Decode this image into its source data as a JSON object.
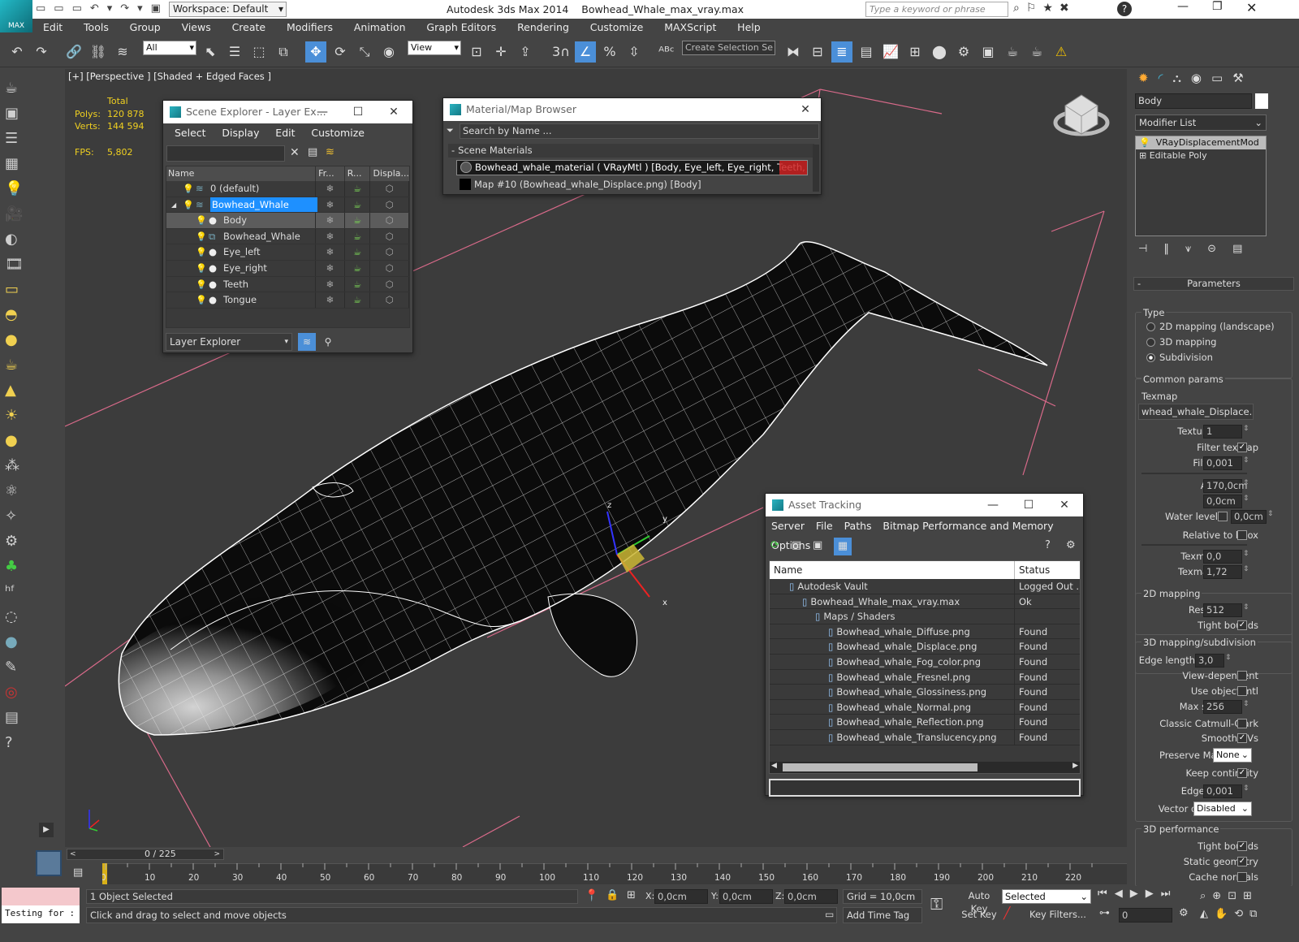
{
  "app": {
    "title": "Autodesk 3ds Max  2014",
    "file": "Bowhead_Whale_max_vray.max",
    "workspace": "Workspace: Default",
    "search_placeholder": "Type a keyword or phrase",
    "logo": "MAX"
  },
  "menu": [
    "Edit",
    "Tools",
    "Group",
    "Views",
    "Create",
    "Modifiers",
    "Animation",
    "Graph Editors",
    "Rendering",
    "Customize",
    "MAXScript",
    "Help"
  ],
  "toolbar": {
    "filter": "All",
    "refcoord": "View",
    "selection_set_placeholder": "Create Selection Se",
    "snap_label": "3"
  },
  "viewport": {
    "label": "[+] [Perspective ] [Shaded + Edged Faces ]",
    "stats": {
      "total_label": "Total",
      "polys_label": "Polys:",
      "polys": "120 878",
      "verts_label": "Verts:",
      "verts": "144 594",
      "fps_label": "FPS:",
      "fps": "5,802"
    },
    "gizmo": {
      "x": "x",
      "y": "y",
      "z": "z"
    }
  },
  "scene_explorer": {
    "title": "Scene Explorer - Layer Ex...",
    "menu": [
      "Select",
      "Display",
      "Edit",
      "Customize"
    ],
    "columns": [
      "Name",
      "Fr...",
      "R...",
      "Displa..."
    ],
    "rows": [
      {
        "name": "0 (default)",
        "indent": 0,
        "type": "layer"
      },
      {
        "name": "Bowhead_Whale",
        "indent": 0,
        "type": "layer",
        "selected": true
      },
      {
        "name": "Body",
        "indent": 1,
        "type": "object",
        "highlight": true
      },
      {
        "name": "Bowhead_Whale",
        "indent": 1,
        "type": "group"
      },
      {
        "name": "Eye_left",
        "indent": 1,
        "type": "object"
      },
      {
        "name": "Eye_right",
        "indent": 1,
        "type": "object"
      },
      {
        "name": "Teeth",
        "indent": 1,
        "type": "object"
      },
      {
        "name": "Tongue",
        "indent": 1,
        "type": "object"
      }
    ],
    "footer": "Layer Explorer"
  },
  "material_browser": {
    "title": "Material/Map Browser",
    "search_placeholder": "Search by Name ...",
    "section": "Scene Materials",
    "items": [
      "Bowhead_whale_material  ( VRayMtl ) [Body, Eye_left, Eye_right, Teeth, Tongue]",
      "Map #10 (Bowhead_whale_Displace.png) [Body]"
    ]
  },
  "asset_tracking": {
    "title": "Asset Tracking",
    "menu": [
      "Server",
      "File",
      "Paths",
      "Bitmap Performance and Memory",
      "Options"
    ],
    "columns": [
      "Name",
      "Status"
    ],
    "rows": [
      {
        "name": "Autodesk Vault",
        "status": "Logged Out ...",
        "indent": 1
      },
      {
        "name": "Bowhead_Whale_max_vray.max",
        "status": "Ok",
        "indent": 2
      },
      {
        "name": "Maps / Shaders",
        "status": "",
        "indent": 3
      },
      {
        "name": "Bowhead_whale_Diffuse.png",
        "status": "Found",
        "indent": 4
      },
      {
        "name": "Bowhead_whale_Displace.png",
        "status": "Found",
        "indent": 4
      },
      {
        "name": "Bowhead_whale_Fog_color.png",
        "status": "Found",
        "indent": 4
      },
      {
        "name": "Bowhead_whale_Fresnel.png",
        "status": "Found",
        "indent": 4
      },
      {
        "name": "Bowhead_whale_Glossiness.png",
        "status": "Found",
        "indent": 4
      },
      {
        "name": "Bowhead_whale_Normal.png",
        "status": "Found",
        "indent": 4
      },
      {
        "name": "Bowhead_whale_Reflection.png",
        "status": "Found",
        "indent": 4
      },
      {
        "name": "Bowhead_whale_Translucency.png",
        "status": "Found",
        "indent": 4
      }
    ]
  },
  "command_panel": {
    "object_name": "Body",
    "modifier_list": "Modifier List",
    "stack": [
      "VRayDisplacementMod",
      "Editable Poly"
    ],
    "rollout": "Parameters",
    "type_label": "Type",
    "type_options": [
      "2D mapping (landscape)",
      "3D mapping",
      "Subdivision"
    ],
    "type_selected": 2,
    "common_label": "Common params",
    "texmap_label": "Texmap",
    "texmap_value": "whead_whale_Displace.png)",
    "texture_chan_label": "Texture chan",
    "texture_chan": "1",
    "filter_texmap_label": "Filter texmap",
    "filter_blur_label": "Filter blur",
    "filter_blur": "0,001",
    "amount_label": "Amount",
    "amount": "170,0cm",
    "shift_label": "Shift",
    "shift": "0,0cm",
    "water_label": "Water level",
    "water": "0,0cm",
    "relative_label": "Relative to bbox",
    "texmap_min_label": "Texmap min",
    "texmap_min": "0,0",
    "texmap_max_label": "Texmap max",
    "texmap_max": "1,72",
    "map2d_label": "2D mapping",
    "resolution_label": "Resolution",
    "resolution": "512",
    "tight_label": "Tight bounds",
    "map3d_label": "3D mapping/subdivision",
    "edge_length_label": "Edge length",
    "edge_length": "3,0",
    "view_dep_label": "View-dependent",
    "use_obj_label": "Use object mtl",
    "max_subdivs_label": "Max subdivs",
    "max_subdivs": "256",
    "catmull_label": "Classic Catmull-Clark",
    "smooth_uv_label": "Smooth UVs",
    "preserve_label": "Preserve Map Bnd",
    "preserve": "None",
    "keep_label": "Keep continuity",
    "edge_thresh_label": "Edge thresh",
    "edge_thresh": "0,001",
    "vector_label": "Vector displ",
    "vector": "Disabled",
    "perf_label": "3D performance",
    "perf_tight_label": "Tight bounds",
    "static_label": "Static geometry",
    "cache_label": "Cache normals"
  },
  "timeline": {
    "frame_label": "0 / 225",
    "ticks": [
      "0",
      "10",
      "20",
      "30",
      "40",
      "50",
      "60",
      "70",
      "80",
      "90",
      "100",
      "110",
      "120",
      "130",
      "140",
      "150",
      "160",
      "170",
      "180",
      "190",
      "200",
      "210",
      "220"
    ]
  },
  "status": {
    "script": "Testing for :",
    "selected": "1 Object Selected",
    "prompt": "Click and drag to select and move objects",
    "x_label": "X:",
    "x": "0,0cm",
    "y_label": "Y:",
    "y": "0,0cm",
    "z_label": "Z:",
    "z": "0,0cm",
    "grid": "Grid = 10,0cm",
    "auto_key": "Auto Key",
    "set_key": "Set Key",
    "key_mode": "Selected",
    "add_time_tag": "Add Time Tag",
    "key_filters": "Key Filters...",
    "frame": "0"
  },
  "colors": {
    "selection_blue": "#1e90ff",
    "trim_red": "#cc2222",
    "teal": "#1fa3b0",
    "bbox_pink": "#d96a8a"
  }
}
